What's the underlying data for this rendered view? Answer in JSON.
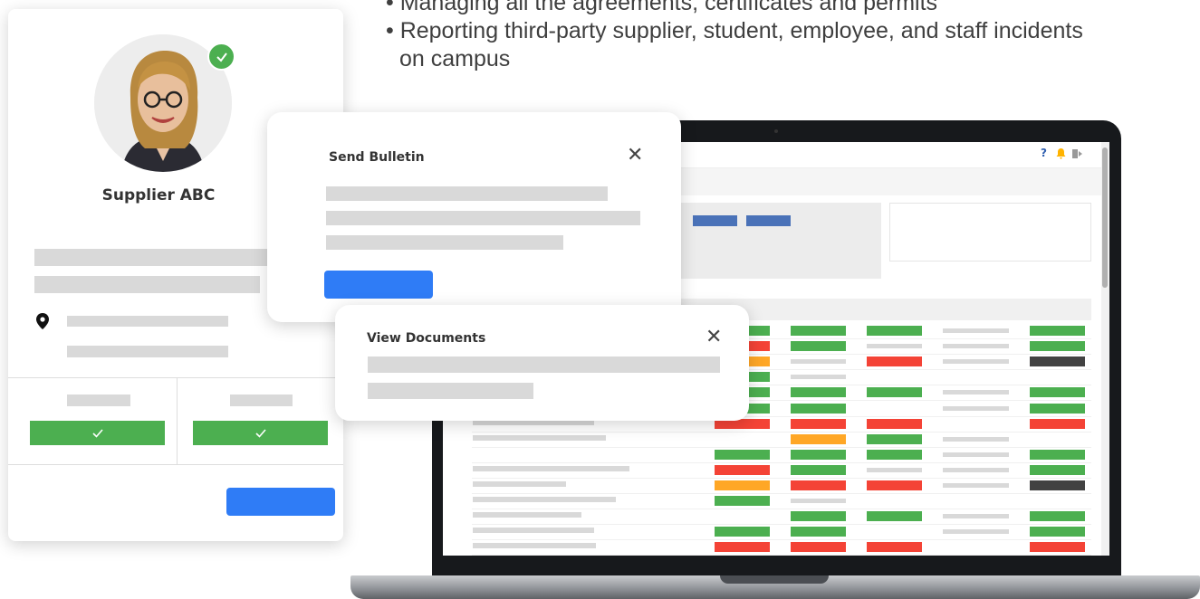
{
  "bullets": {
    "line1": "• Managing all the agreements, certificates and permits",
    "line2": "• Reporting third-party supplier, student, employee, and staff incidents",
    "line3": "on campus"
  },
  "profile": {
    "name": "Supplier ABC",
    "verified_icon": "check-circle-icon",
    "location_icon": "location-pin-icon"
  },
  "send_bulletin": {
    "title": "Send Bulletin",
    "close": "✕"
  },
  "view_documents": {
    "title": "View Documents",
    "close": "✕"
  },
  "app_header": {
    "help": "?",
    "icons": [
      "help-icon",
      "bell-icon",
      "logout-icon"
    ]
  },
  "colors": {
    "green": "#4caf50",
    "red": "#f44336",
    "orange": "#ffa726",
    "dark": "#424242",
    "blue": "#2f7cf6",
    "placeholder": "#d9d9d9"
  },
  "status_rows": [
    [
      "green",
      "",
      "green",
      "green",
      "grey",
      "green"
    ],
    [
      "red",
      "",
      "green",
      "grey",
      "grey",
      "green"
    ],
    [
      "orange",
      "",
      "grey",
      "red",
      "grey",
      "dark"
    ],
    [
      "green",
      "",
      "grey",
      "",
      "",
      ""
    ],
    [
      "green",
      "",
      "green",
      "green",
      "grey",
      "green"
    ],
    [
      "green",
      "",
      "green",
      "",
      "grey",
      "green"
    ],
    [
      "red",
      "",
      "red",
      "red",
      "",
      "red"
    ],
    [
      "",
      "",
      "orange",
      "green",
      "grey",
      ""
    ],
    [
      "green",
      "",
      "green",
      "green",
      "grey",
      "green"
    ],
    [
      "red",
      "",
      "green",
      "grey",
      "grey",
      "green"
    ],
    [
      "orange",
      "",
      "red",
      "red",
      "grey",
      "dark"
    ],
    [
      "green",
      "",
      "grey",
      "",
      "",
      ""
    ],
    [
      "",
      "",
      "green",
      "green",
      "grey",
      "green"
    ],
    [
      "green",
      "",
      "green",
      "",
      "grey",
      "green"
    ],
    [
      "red",
      "",
      "red",
      "red",
      "",
      "red"
    ]
  ]
}
